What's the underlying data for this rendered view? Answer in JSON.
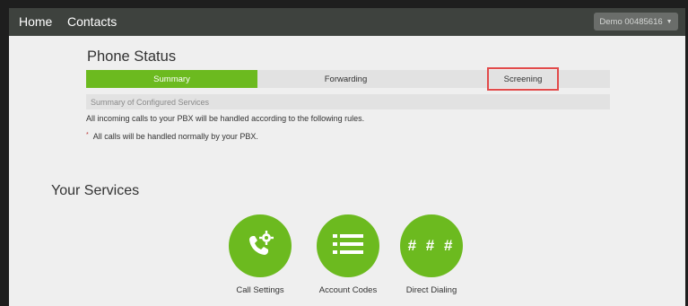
{
  "nav": {
    "home": "Home",
    "contacts": "Contacts",
    "account": "Demo 00485616"
  },
  "phone_status": {
    "title": "Phone Status",
    "tabs": [
      {
        "label": "Summary",
        "active": true
      },
      {
        "label": "Forwarding",
        "active": false
      },
      {
        "label": "Screening",
        "active": false,
        "highlighted": true
      }
    ],
    "summary_header": "Summary of Configured Services",
    "info": "All incoming calls to your PBX will be handled according to the following rules.",
    "rules": [
      "All calls will be handled normally by your PBX."
    ]
  },
  "services": {
    "title": "Your Services",
    "items": [
      {
        "label": "Call Settings",
        "icon": "phone-gear-icon"
      },
      {
        "label": "Account Codes",
        "icon": "list-icon"
      },
      {
        "label": "Direct Dialing",
        "icon": "hash-icon",
        "icon_text": "# # #"
      }
    ]
  },
  "colors": {
    "accent": "#6cba1f",
    "topbar": "#3e423e",
    "highlight_border": "#e24a4a"
  }
}
